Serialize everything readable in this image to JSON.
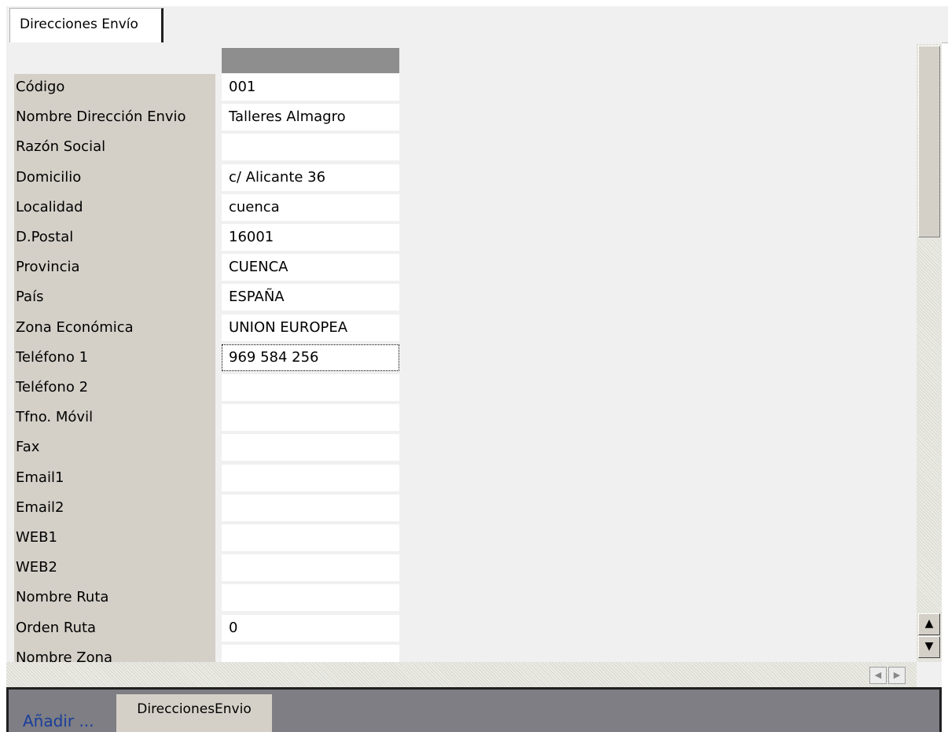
{
  "tab": {
    "label": "Direcciones Envío"
  },
  "fields": [
    {
      "label": "Código",
      "value": "001"
    },
    {
      "label": "Nombre Dirección Envio",
      "value": "Talleres Almagro"
    },
    {
      "label": "Razón Social",
      "value": ""
    },
    {
      "label": "Domicilio",
      "value": "c/ Alicante 36"
    },
    {
      "label": "Localidad",
      "value": "cuenca"
    },
    {
      "label": "D.Postal",
      "value": "16001"
    },
    {
      "label": "Provincia",
      "value": "CUENCA"
    },
    {
      "label": "País",
      "value": "ESPAÑA"
    },
    {
      "label": "Zona Económica",
      "value": "UNION EUROPEA"
    },
    {
      "label": "Teléfono 1",
      "value": "969 584 256"
    },
    {
      "label": "Teléfono 2",
      "value": ""
    },
    {
      "label": "Tfno. Móvil",
      "value": ""
    },
    {
      "label": "Fax",
      "value": ""
    },
    {
      "label": "Email1",
      "value": ""
    },
    {
      "label": "Email2",
      "value": ""
    },
    {
      "label": "WEB1",
      "value": ""
    },
    {
      "label": "WEB2",
      "value": ""
    },
    {
      "label": "Nombre Ruta",
      "value": ""
    },
    {
      "label": "Orden Ruta",
      "value": "0"
    },
    {
      "label": "Nombre Zona",
      "value": ""
    }
  ],
  "focused_field": "Teléfono 1",
  "scrollbar": {
    "up": "▲",
    "down": "▼",
    "left": "◀",
    "right": "▶"
  },
  "bottom": {
    "add_label": "Añadir ...",
    "tab_label": "DireccionesEnvio"
  },
  "colors": {
    "label_bg": "#d4d0c8",
    "header": "#8e8e8e",
    "link": "#1a3e9c"
  }
}
